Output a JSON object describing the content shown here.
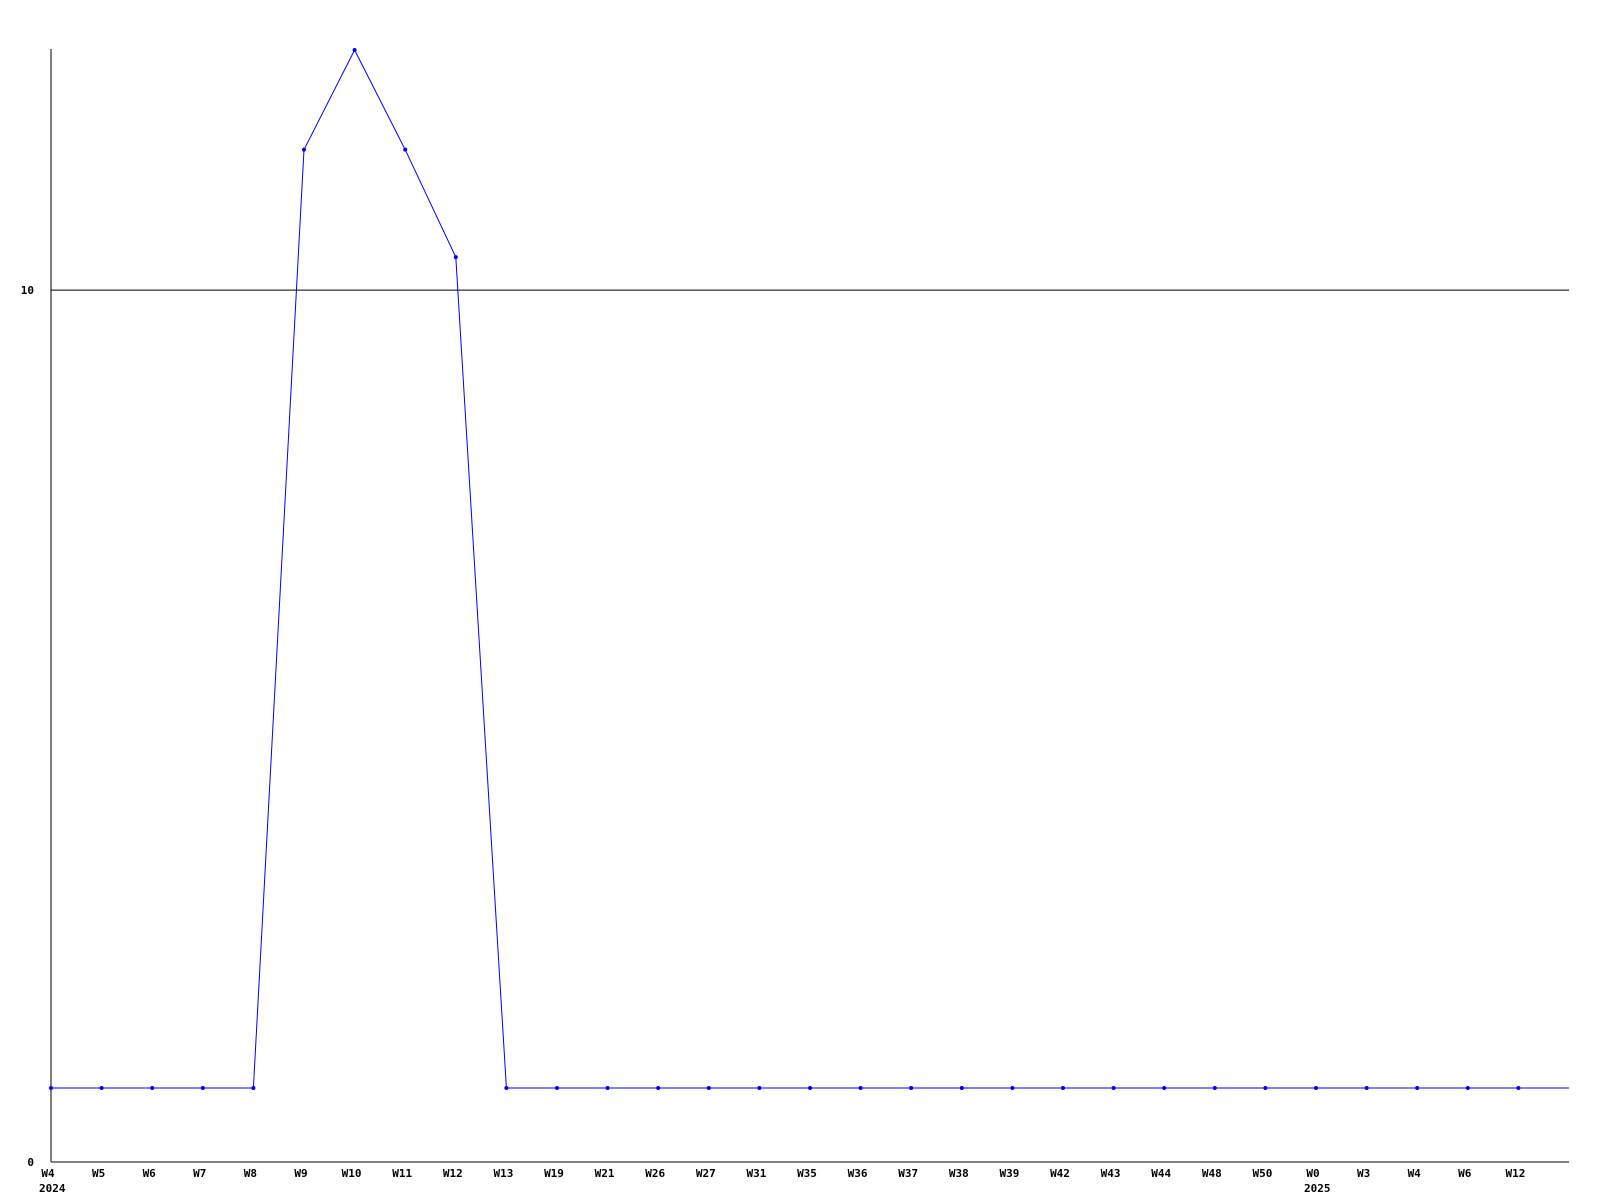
{
  "chart_data": {
    "type": "line",
    "title": "",
    "xlabel": "",
    "ylabel": "",
    "y_scale": "log",
    "ylim": [
      0,
      20
    ],
    "y_ticks": [
      {
        "value": 0,
        "label": "0"
      },
      {
        "value": 10,
        "label": "10"
      }
    ],
    "reference_line": {
      "value": 10
    },
    "categories": [
      "W4",
      "W5",
      "W6",
      "W7",
      "W8",
      "W9",
      "W10",
      "W11",
      "W12",
      "W13",
      "W19",
      "W21",
      "W26",
      "W27",
      "W31",
      "W35",
      "W36",
      "W37",
      "W38",
      "W39",
      "W42",
      "W43",
      "W44",
      "W48",
      "W50",
      "W0",
      "W3",
      "W4",
      "W6",
      "W12"
    ],
    "year_labels": [
      {
        "index": 0,
        "label": "2024"
      },
      {
        "index": 25,
        "label": "2025"
      }
    ],
    "series": [
      {
        "values": [
          1,
          1,
          1,
          1,
          1,
          15,
          20,
          15,
          11,
          1,
          1,
          1,
          1,
          1,
          1,
          1,
          1,
          1,
          1,
          1,
          1,
          1,
          1,
          1,
          1,
          1,
          1,
          1,
          1,
          1
        ],
        "color": "#0000ff"
      }
    ],
    "grid": false,
    "legend": "none"
  }
}
